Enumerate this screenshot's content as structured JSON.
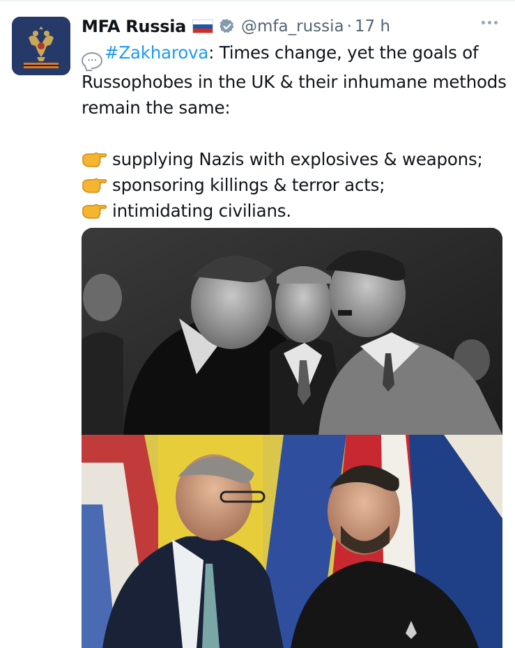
{
  "tweet": {
    "display_name": "MFA Russia",
    "handle": "@mfa_russia",
    "separator": "·",
    "time": "17 h",
    "flag_icon": "russian-flag-icon",
    "verified_icon": "gray-verified-badge-icon",
    "speech_icon": "speech-balloon-emoji",
    "speech_glyph": "…",
    "hashtag": "#Zakharova",
    "intro": ": Times change, yet the goals of Russophobes in the UK & their inhumane methods remain the same:",
    "bullets": [
      "supplying Nazis with explosives & weapons;",
      "sponsoring killings & terror acts;",
      "intimidating civilians."
    ],
    "bullet_icon": "backhand-index-pointing-right-emoji"
  },
  "media": {
    "images": [
      {
        "kind": "black-and-white historical photo"
      },
      {
        "kind": "color photo"
      }
    ]
  },
  "colors": {
    "hashtag": "#1d9bf0",
    "secondary_text": "#536471",
    "avatar_bg": "#263a6a",
    "flag_white": "#ffffff",
    "flag_blue": "#1c57a5",
    "flag_red": "#d52b1e"
  }
}
